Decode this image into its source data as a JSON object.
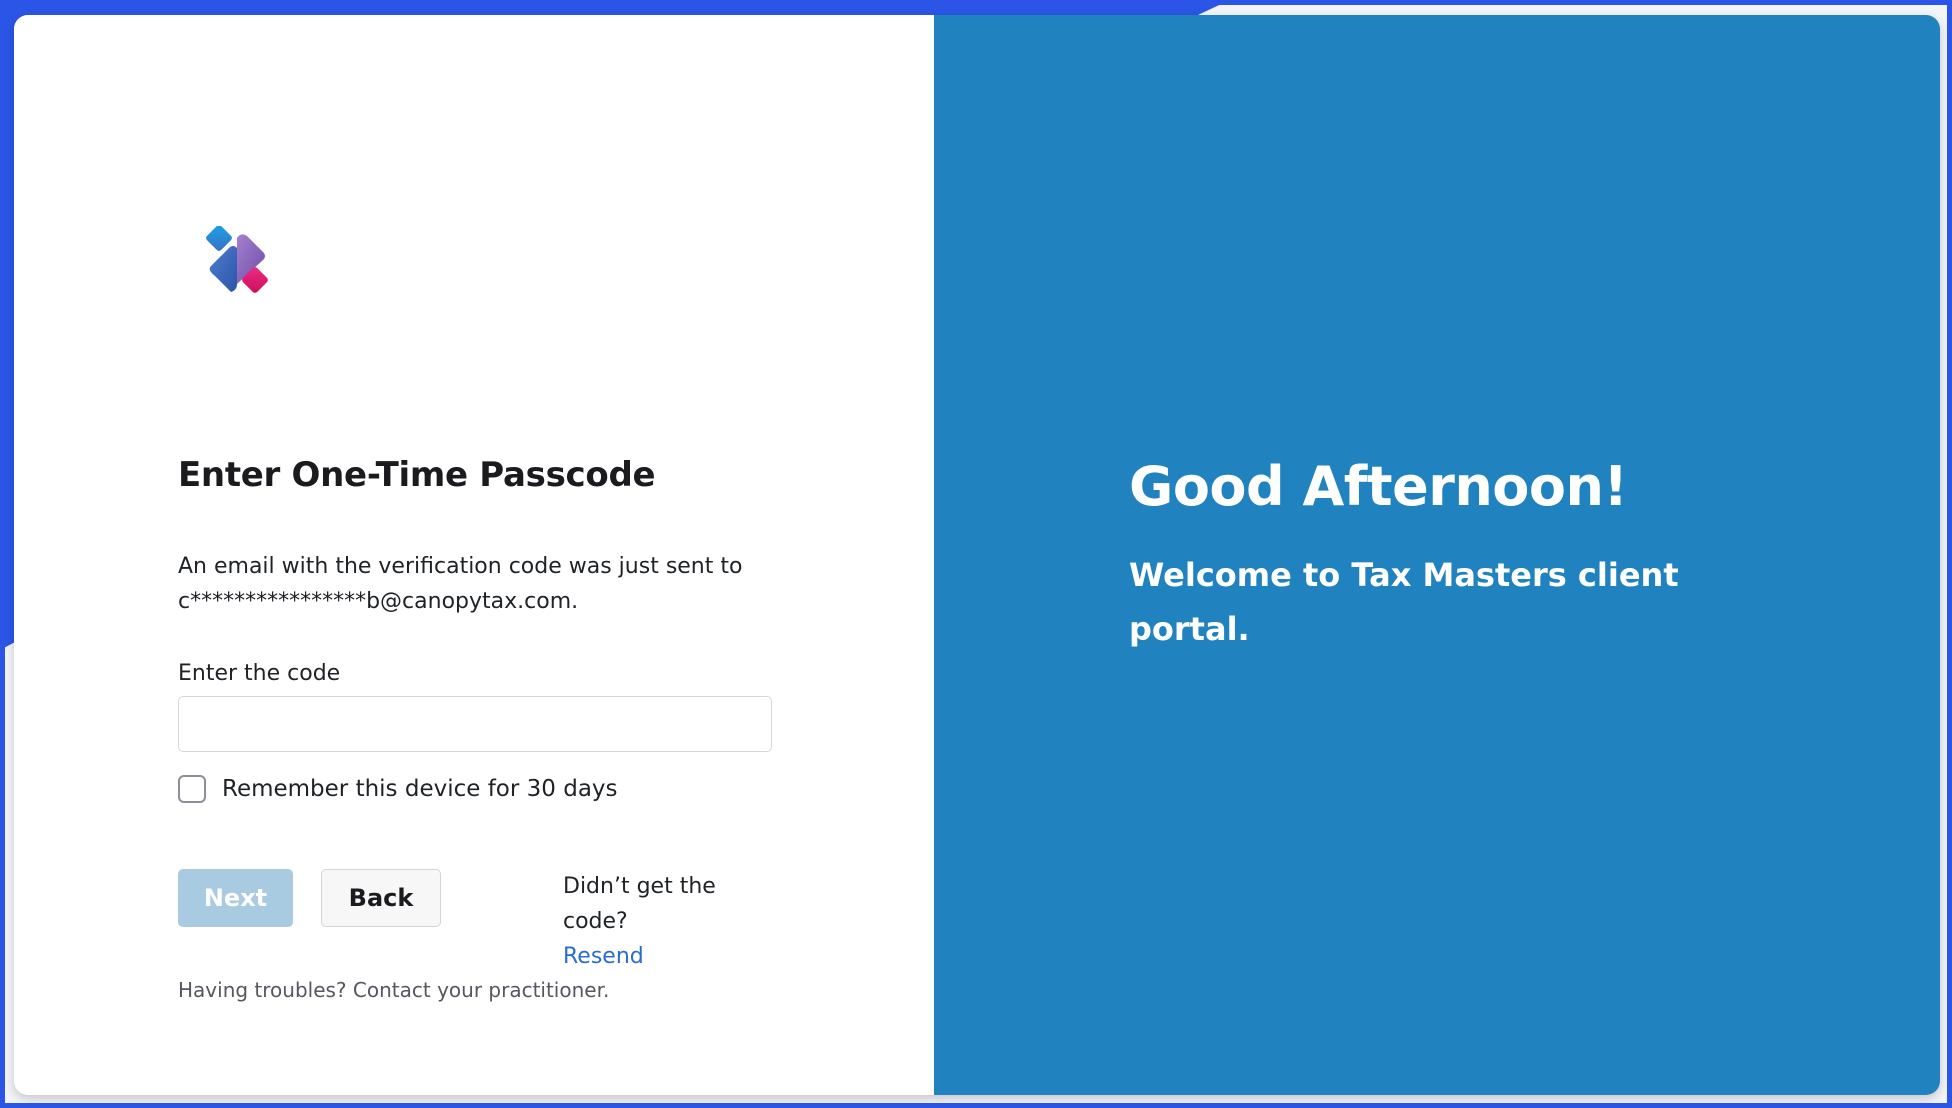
{
  "logo": {
    "icon": "canopy-logo-icon",
    "colors": [
      "#1aa3e8",
      "#8a63b8",
      "#e0176b",
      "#3b6fc0"
    ]
  },
  "login": {
    "title": "Enter One-Time Passcode",
    "description_line1": "An email with the verification code was just sent to",
    "description_line2": "c****************b@canopytax.com.",
    "code_label": "Enter the code",
    "code_value": "",
    "code_placeholder": "",
    "remember_label": "Remember this device for 30 days",
    "remember_checked": false,
    "next_label": "Next",
    "back_label": "Back",
    "resend_prompt": "Didn’t get the code?",
    "resend_label": "Resend",
    "help_text": "Having troubles? Contact your practitioner."
  },
  "welcome": {
    "greeting": "Good Afternoon!",
    "message": "Welcome to Tax Masters client portal."
  },
  "colors": {
    "panel_blue": "#2082be",
    "link_blue": "#2c6ccf",
    "next_disabled": "#a8cbe2",
    "frame_blue": "#2b55e6"
  }
}
